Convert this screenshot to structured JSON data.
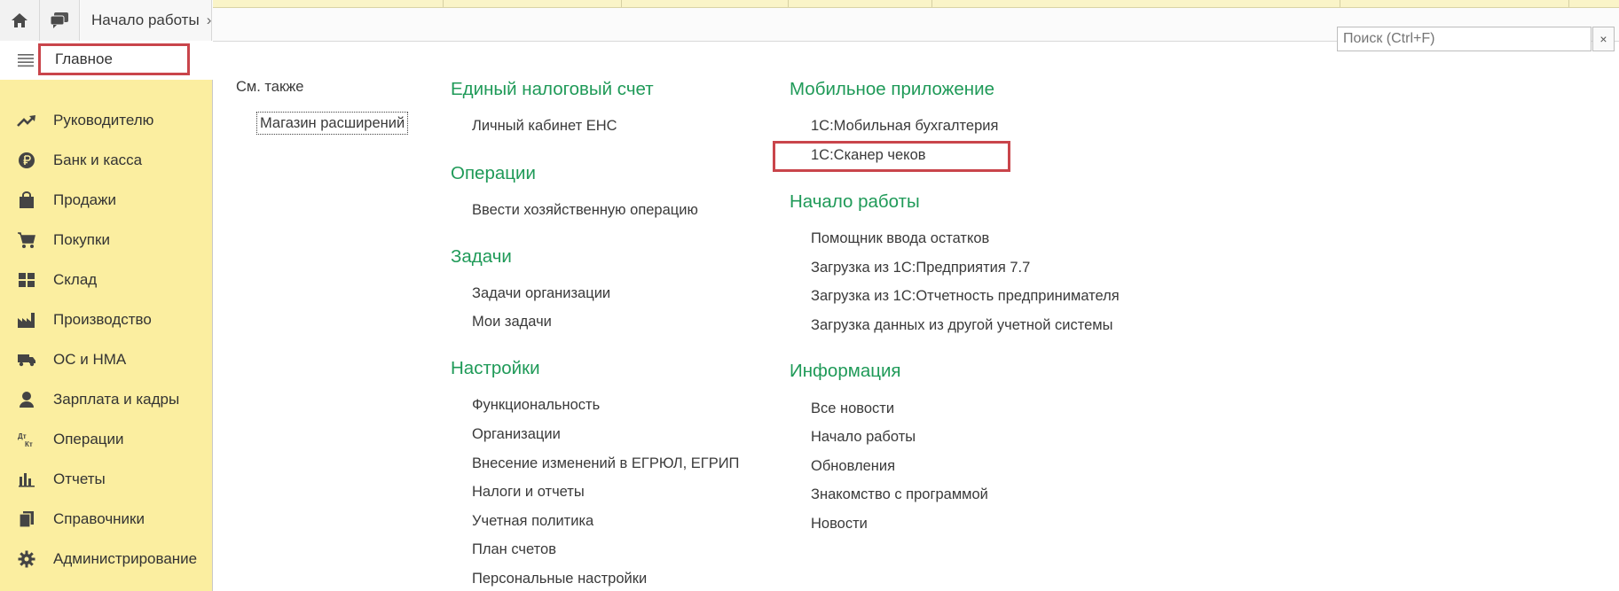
{
  "topbar": {
    "home_icon": "home-icon",
    "chat_icon": "chat-icon",
    "tab_label": "Начало работы",
    "tab_chevron": "›"
  },
  "sidebar": {
    "menu_icon": "hamburger-icon",
    "main_label": "Главное",
    "items": [
      {
        "label": "Руководителю",
        "icon": "trend-up-icon"
      },
      {
        "label": "Банк и касса",
        "icon": "ruble-coin-icon"
      },
      {
        "label": "Продажи",
        "icon": "shopping-bag-icon"
      },
      {
        "label": "Покупки",
        "icon": "shopping-cart-icon"
      },
      {
        "label": "Склад",
        "icon": "warehouse-icon"
      },
      {
        "label": "Производство",
        "icon": "factory-icon"
      },
      {
        "label": "ОС и НМА",
        "icon": "truck-icon"
      },
      {
        "label": "Зарплата и кадры",
        "icon": "person-icon"
      },
      {
        "label": "Операции",
        "icon": "debit-credit-icon"
      },
      {
        "label": "Отчеты",
        "icon": "bar-chart-icon"
      },
      {
        "label": "Справочники",
        "icon": "books-icon"
      },
      {
        "label": "Администрирование",
        "icon": "gear-icon"
      }
    ]
  },
  "search": {
    "placeholder": "Поиск (Ctrl+F)",
    "clear_label": "×"
  },
  "see_also": {
    "title": "См. также",
    "link": "Магазин расширений"
  },
  "columns": {
    "col1": [
      {
        "title": "Единый налоговый счет",
        "links": [
          "Личный кабинет ЕНС"
        ]
      },
      {
        "title": "Операции",
        "links": [
          "Ввести хозяйственную операцию"
        ]
      },
      {
        "title": "Задачи",
        "links": [
          "Задачи организации",
          "Мои задачи"
        ]
      },
      {
        "title": "Настройки",
        "links": [
          "Функциональность",
          "Организации",
          "Внесение изменений в ЕГРЮЛ, ЕГРИП",
          "Налоги и отчеты",
          "Учетная политика",
          "План счетов",
          "Персональные настройки"
        ]
      }
    ],
    "col2": [
      {
        "title": "Мобильное приложение",
        "links": [
          "1С:Мобильная бухгалтерия",
          "1С:Сканер чеков"
        ]
      },
      {
        "title": "Начало работы",
        "links": [
          "Помощник ввода остатков",
          "Загрузка из 1С:Предприятия 7.7",
          "Загрузка из 1С:Отчетность предпринимателя",
          "Загрузка данных из другой учетной системы"
        ]
      },
      {
        "title": "Информация",
        "links": [
          "Все новости",
          "Начало работы",
          "Обновления",
          "Знакомство с программой",
          "Новости"
        ]
      }
    ]
  },
  "colors": {
    "sidebar_bg": "#fbeea0",
    "section_heading": "#1f9a58",
    "highlight_border": "#c9454b"
  }
}
